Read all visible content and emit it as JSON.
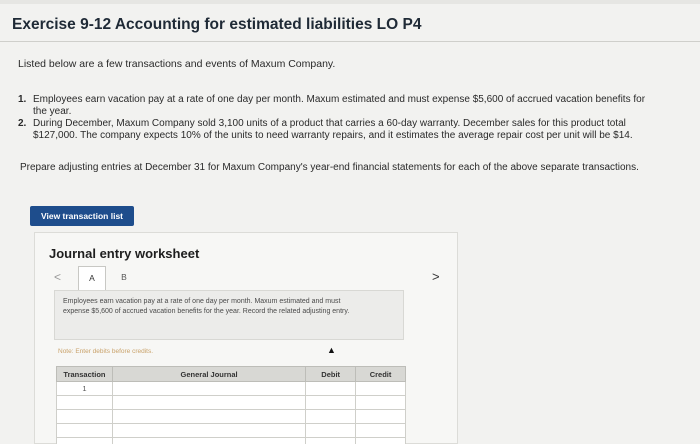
{
  "page": {
    "title": "Exercise 9-12 Accounting for estimated liabilities LO P4",
    "intro": "Listed below are a few transactions and events of Maxum Company."
  },
  "items": [
    {
      "num": "1.",
      "text": "Employees earn vacation pay at a rate of one day per month. Maxum estimated and must expense $5,600 of accrued vacation benefits for the year."
    },
    {
      "num": "2.",
      "text": "During December, Maxum Company sold 3,100 units of a product that carries a 60-day warranty. December sales for this product total $127,000. The company expects 10% of the units to need warranty repairs, and it estimates the average repair cost per unit will be $14."
    }
  ],
  "instructions": "Prepare adjusting entries at December 31 for Maxum Company's year-end financial statements for each of the above separate transactions.",
  "buttons": {
    "view_transactions": "View transaction list"
  },
  "worksheet": {
    "title": "Journal entry worksheet",
    "prev_icon": "chevron-left-icon",
    "next_icon": "chevron-right-icon",
    "prev_glyph": "<",
    "next_glyph": ">",
    "tabs": [
      {
        "label": "A",
        "active": true
      },
      {
        "label": "B",
        "active": false
      }
    ],
    "description": "Employees earn vacation pay at a rate of one day per month. Maxum estimated and must expense $5,600 of accrued vacation benefits for the year. Record the related adjusting entry.",
    "note": "Note: Enter debits before credits.",
    "table": {
      "headers": [
        "Transaction",
        "General Journal",
        "Debit",
        "Credit"
      ],
      "rows": [
        [
          "1",
          "",
          "",
          ""
        ],
        [
          "",
          "",
          "",
          ""
        ],
        [
          "",
          "",
          "",
          ""
        ],
        [
          "",
          "",
          "",
          ""
        ],
        [
          "",
          "",
          "",
          ""
        ]
      ]
    }
  },
  "colors": {
    "button_bg": "#1e4d8c",
    "note_color": "#c9a26a"
  }
}
